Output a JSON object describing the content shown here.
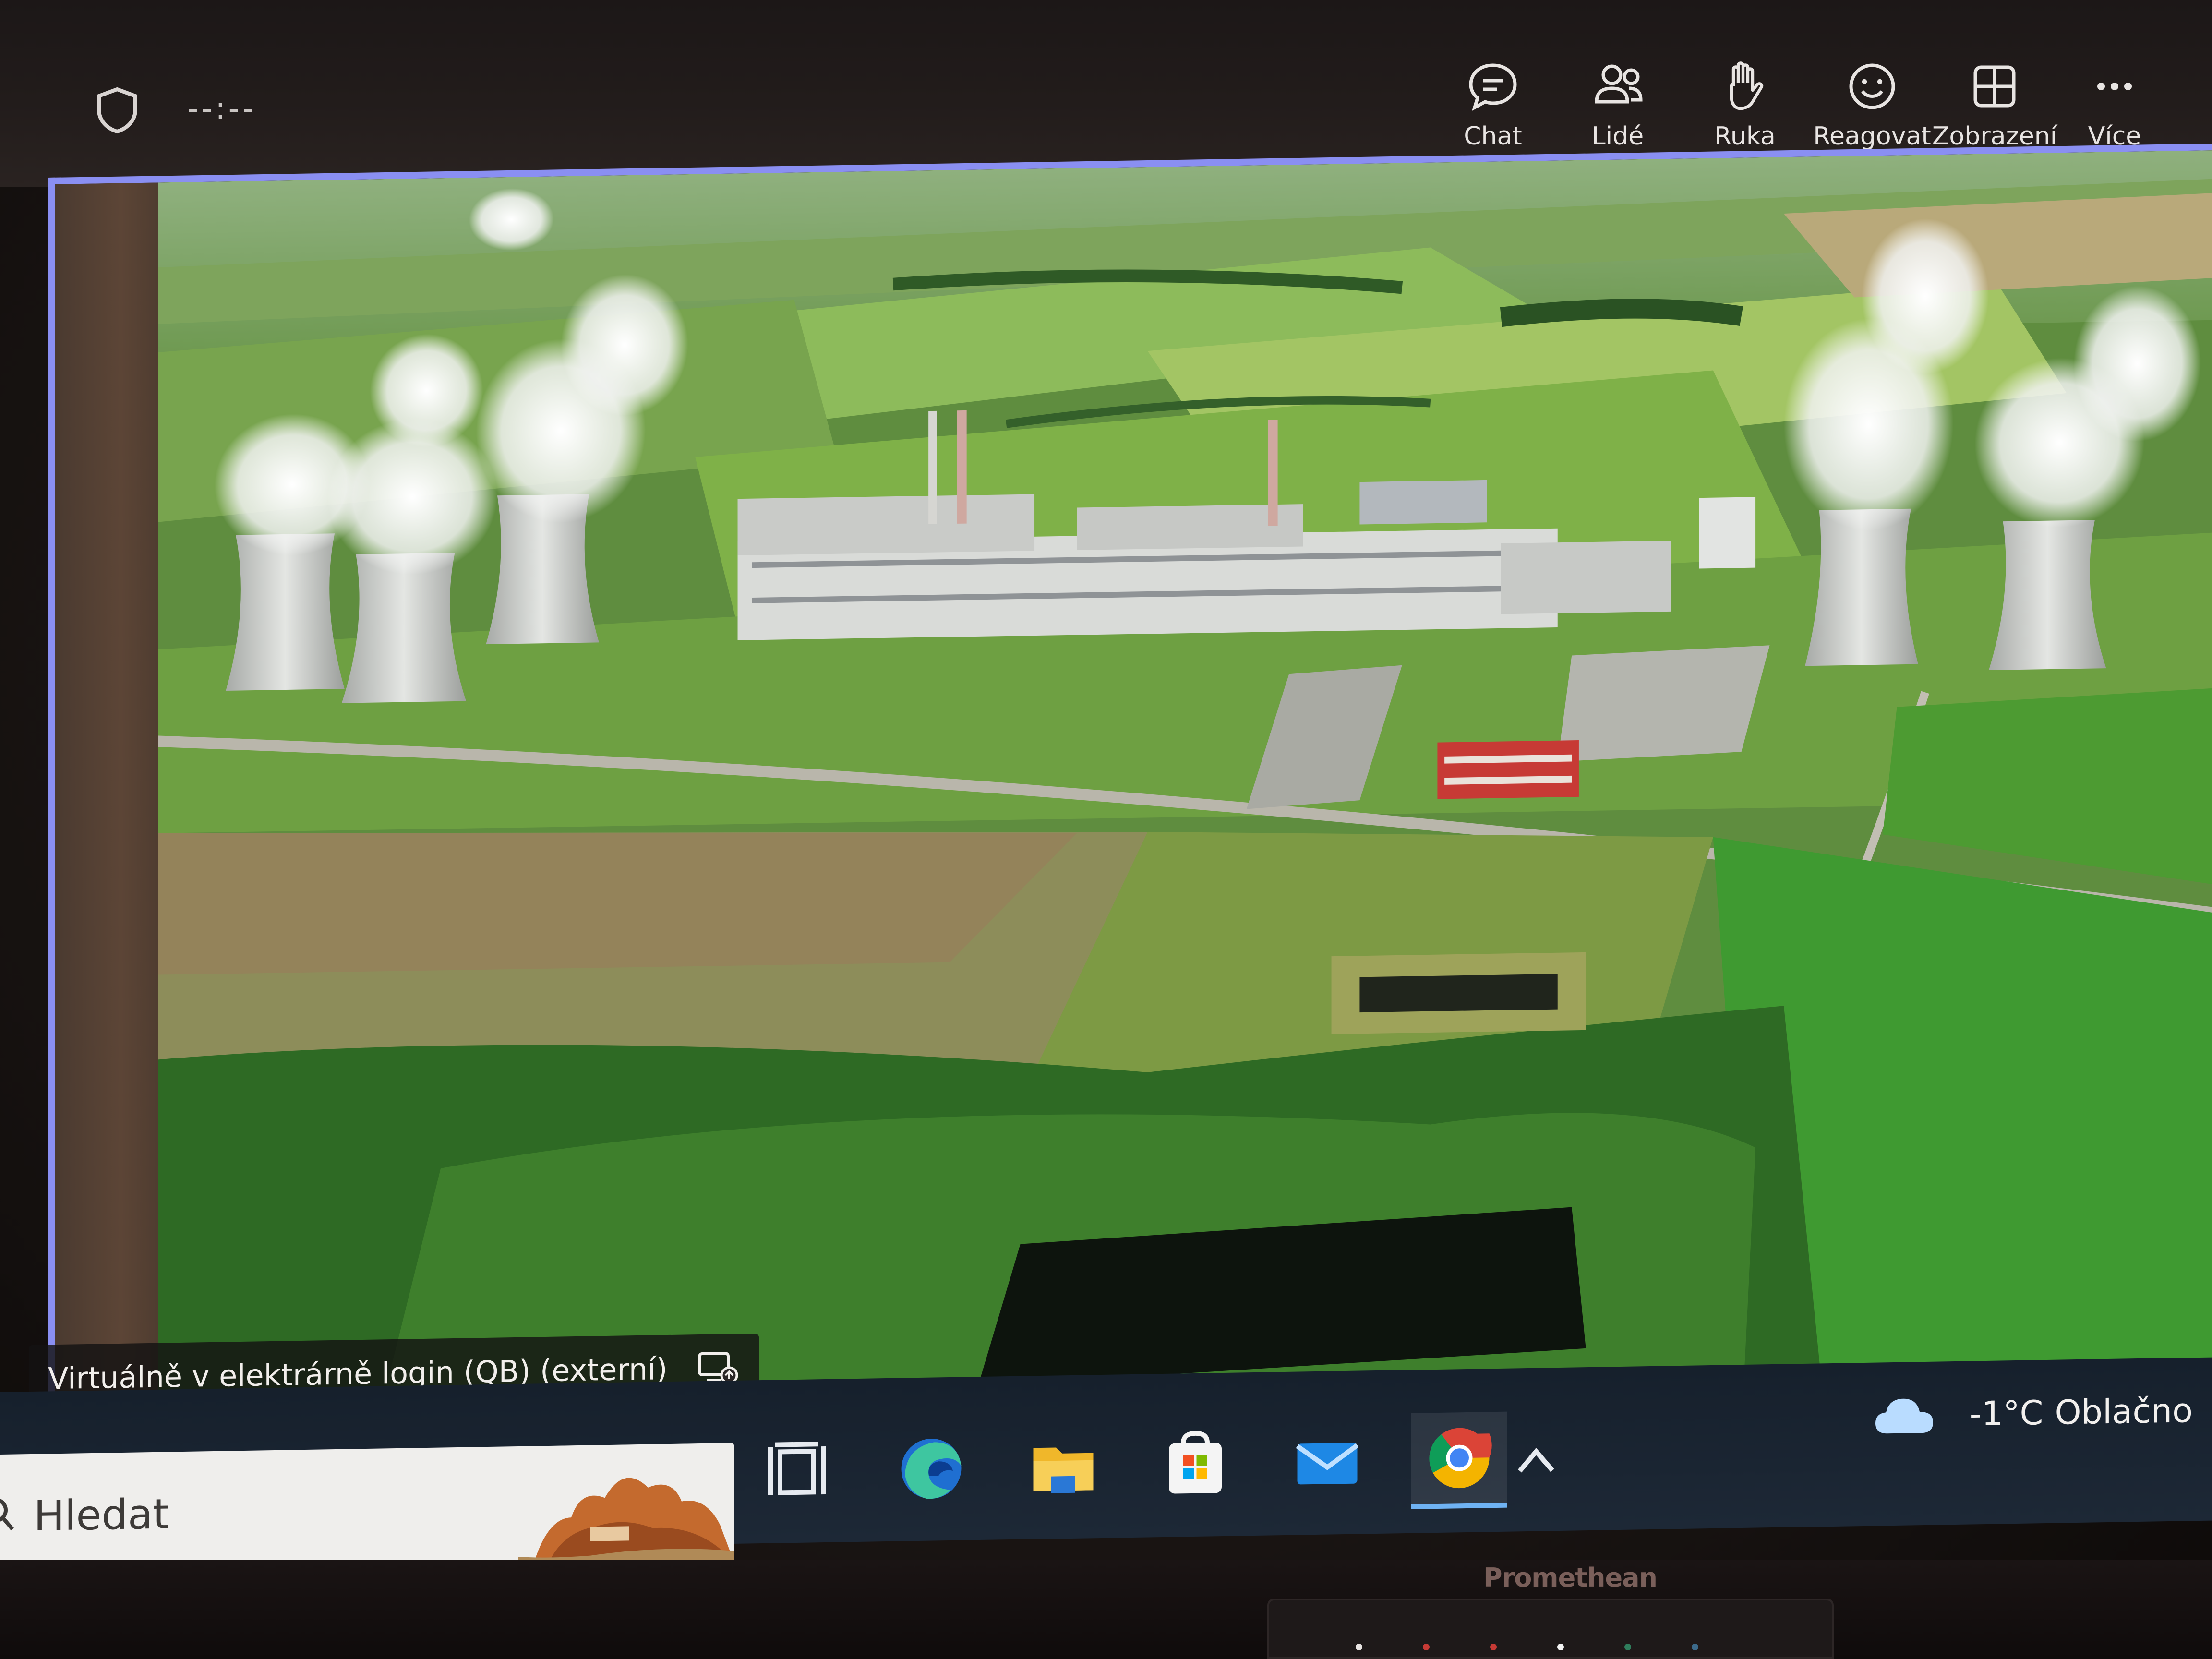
{
  "topbar": {
    "call_timer": "--:--",
    "buttons": [
      {
        "label": "Chat",
        "icon": "chat-icon"
      },
      {
        "label": "Lidé",
        "icon": "people-icon"
      },
      {
        "label": "Ruka",
        "icon": "raise-hand-icon"
      },
      {
        "label": "Reagovat",
        "icon": "react-smiley-icon"
      },
      {
        "label": "Zobrazení",
        "icon": "view-grid-icon"
      },
      {
        "label": "Více",
        "icon": "more-dots-icon"
      }
    ]
  },
  "shared_screen": {
    "participant_label": "Virtuálně v elektrárně login (QB) (externí)",
    "label_icon": "screen-share-icon",
    "content": "aerial-photo-power-plant"
  },
  "taskbar": {
    "search_placeholder": "Hledat",
    "apps": [
      {
        "name": "task-view",
        "icon": "task-view-icon"
      },
      {
        "name": "edge",
        "icon": "edge-icon"
      },
      {
        "name": "file-explorer",
        "icon": "folder-icon"
      },
      {
        "name": "microsoft-store",
        "icon": "store-icon"
      },
      {
        "name": "mail",
        "icon": "mail-icon"
      },
      {
        "name": "chrome",
        "icon": "chrome-icon",
        "active": true
      }
    ],
    "weather": {
      "temperature": "-1°C",
      "condition": "Oblačno",
      "icon": "cloud-icon"
    }
  },
  "monitor": {
    "brand": "Promethean"
  },
  "colors": {
    "share_border": "#8a8ff2",
    "taskbar_bg": "#1d2836",
    "active_indicator": "#6fb3f3"
  }
}
